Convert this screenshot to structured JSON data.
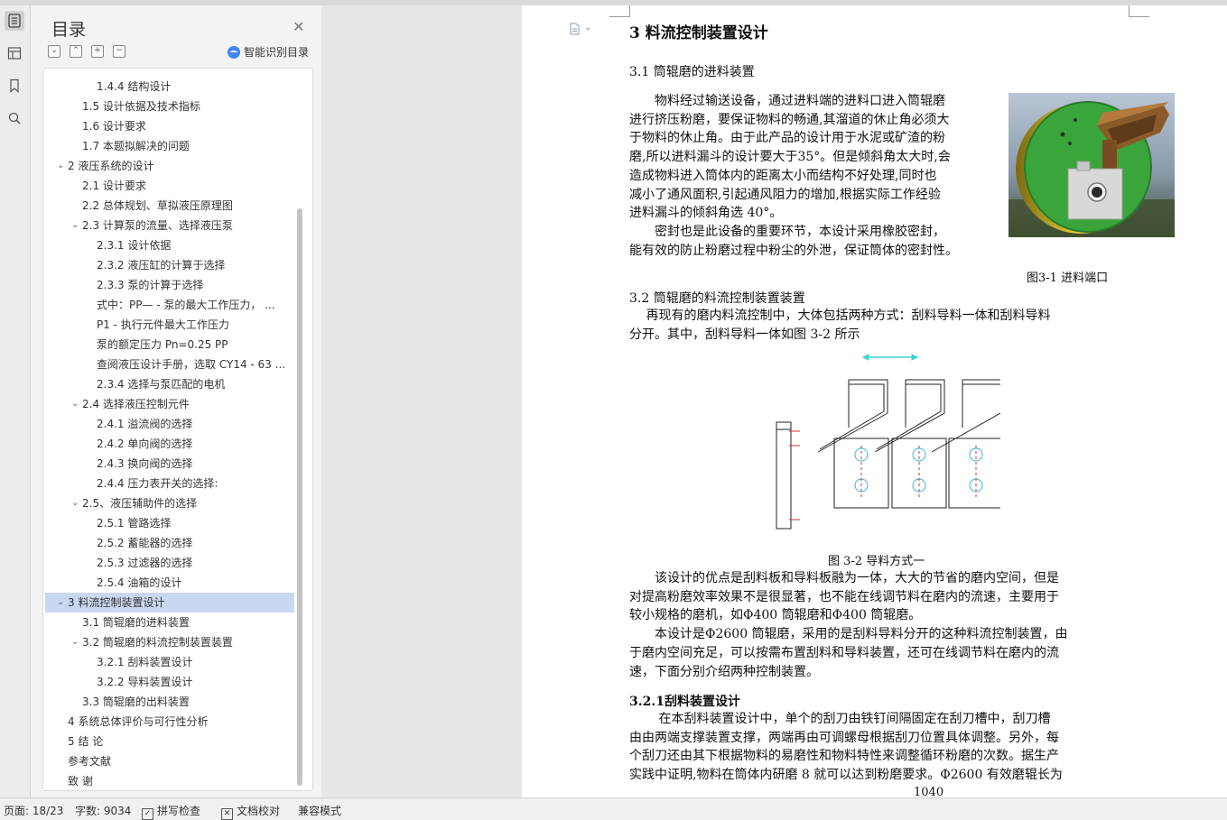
{
  "toc": {
    "title": "目录",
    "smart_label": "智能识别目录",
    "items": [
      {
        "label": "1.4.4  结构设计",
        "level": 3,
        "expandable": false,
        "selected": false
      },
      {
        "label": "1.5  设计依据及技术指标",
        "level": 2,
        "expandable": false,
        "selected": false
      },
      {
        "label": "1.6  设计要求",
        "level": 2,
        "expandable": false,
        "selected": false
      },
      {
        "label": "1.7  本题拟解决的问题",
        "level": 2,
        "expandable": false,
        "selected": false
      },
      {
        "label": "2   液压系统的设计",
        "level": 1,
        "expandable": true,
        "selected": false
      },
      {
        "label": "2.1  设计要求",
        "level": 2,
        "expandable": false,
        "selected": false
      },
      {
        "label": "2.2  总体规划、草拟液压原理图",
        "level": 2,
        "expandable": false,
        "selected": false
      },
      {
        "label": "2.3  计算泵的流量、选择液压泵",
        "level": 2,
        "expandable": true,
        "selected": false
      },
      {
        "label": "2.3.1  设计依据",
        "level": 3,
        "expandable": false,
        "selected": false
      },
      {
        "label": "2.3.2  液压缸的计算于选择",
        "level": 3,
        "expandable": false,
        "selected": false
      },
      {
        "label": "2.3.3  泵的计算于选择",
        "level": 3,
        "expandable": false,
        "selected": false
      },
      {
        "label": " 式中：PP— - 泵的最大工作压力， ...",
        "level": 3,
        "expandable": false,
        "selected": false
      },
      {
        "label": "P1 - 执行元件最大工作压力",
        "level": 3,
        "expandable": false,
        "selected": false
      },
      {
        "label": "泵的额定压力 Pn=0.25 PP",
        "level": 3,
        "expandable": false,
        "selected": false
      },
      {
        "label": "查阅液压设计手册，选取 CY14 - 63 ...",
        "level": 3,
        "expandable": false,
        "selected": false
      },
      {
        "label": "2.3.4  选择与泵匹配的电机",
        "level": 3,
        "expandable": false,
        "selected": false
      },
      {
        "label": "2.4  选择液压控制元件",
        "level": 2,
        "expandable": true,
        "selected": false
      },
      {
        "label": "2.4.1  溢流阀的选择",
        "level": 3,
        "expandable": false,
        "selected": false
      },
      {
        "label": "2.4.2  单向阀的选择",
        "level": 3,
        "expandable": false,
        "selected": false
      },
      {
        "label": "2.4.3  换向阀的选择",
        "level": 3,
        "expandable": false,
        "selected": false
      },
      {
        "label": "2.4.4  压力表开关的选择:",
        "level": 3,
        "expandable": false,
        "selected": false
      },
      {
        "label": "2.5、液压辅助件的选择",
        "level": 2,
        "expandable": true,
        "selected": false
      },
      {
        "label": "2.5.1  管路选择",
        "level": 3,
        "expandable": false,
        "selected": false
      },
      {
        "label": "2.5.2  蓄能器的选择",
        "level": 3,
        "expandable": false,
        "selected": false
      },
      {
        "label": "2.5.3  过滤器的选择",
        "level": 3,
        "expandable": false,
        "selected": false
      },
      {
        "label": "2.5.4  油箱的设计",
        "level": 3,
        "expandable": false,
        "selected": false
      },
      {
        "label": "3   料流控制装置设计",
        "level": 1,
        "expandable": true,
        "selected": true
      },
      {
        "label": "3.1  筒辊磨的进料装置",
        "level": 2,
        "expandable": false,
        "selected": false
      },
      {
        "label": "3.2  筒辊磨的料流控制装置装置",
        "level": 2,
        "expandable": true,
        "selected": false
      },
      {
        "label": "3.2.1 刮料装置设计",
        "level": 3,
        "expandable": false,
        "selected": false
      },
      {
        "label": "3.2.2  导料装置设计",
        "level": 3,
        "expandable": false,
        "selected": false
      },
      {
        "label": "3.3  筒辊磨的出料装置",
        "level": 2,
        "expandable": false,
        "selected": false
      },
      {
        "label": "4 系统总体评价与可行性分析",
        "level": 0,
        "expandable": false,
        "selected": false
      },
      {
        "label": "5 结   论",
        "level": 0,
        "expandable": false,
        "selected": false
      },
      {
        "label": "参考文献",
        "level": 0,
        "expandable": false,
        "selected": false
      },
      {
        "label": "致   谢",
        "level": 0,
        "expandable": false,
        "selected": false
      }
    ]
  },
  "doc": {
    "heading": "3   料流控制装置设计",
    "sec31": "3.1  筒辊磨的进料装置",
    "p1": [
      "　　物料经过输送设备，通过进料端的进料口进入筒辊磨",
      "进行挤压粉磨，要保证物料的畅通,其溜道的休止角必须大",
      "于物料的休止角。由于此产品的设计用于水泥或矿渣的粉",
      "磨,所以进料漏斗的设计要大于35°。但是倾斜角太大时,会",
      "造成物料进入筒体内的距离太小而结构不好处理,同时也",
      "减小了通风面积,引起通风阻力的增加,根据实际工作经验",
      "进料漏斗的倾斜角选 40°。"
    ],
    "p2": [
      "　　密封也是此设备的重要环节，本设计采用橡胶密封，",
      "能有效的防止粉磨过程中粉尘的外泄，保证筒体的密封性。"
    ],
    "fig1_caption": "图3-1 进料端口",
    "sec32": "3.2  筒辊磨的料流控制装置装置",
    "p3": [
      "　 再现有的磨内料流控制中，大体包括两种方式：刮料导料一体和刮料导料",
      "分开。其中，刮料导料一体如图 3-2 所示"
    ],
    "fig2_caption": "图 3-2   导料方式一",
    "p4": [
      "　　该设计的优点是刮料板和导料板融为一体，大大的节省的磨内空间，但是",
      "对提高粉磨效率效果不是很显著，也不能在线调节料在磨内的流速，主要用于",
      "较小规格的磨机，如Φ400 筒辊磨和Φ400 筒辊磨。",
      "　　本设计是Φ2600 筒辊磨，采用的是刮料导料分开的这种料流控制装置，由",
      "于磨内空间充足，可以按需布置刮料和导料装置，还可在线调节料在磨内的流",
      "速，下面分别介绍两种控制装置。"
    ],
    "sec321": "3.2.1刮料装置设计",
    "p5": [
      "　　 在本刮料装置设计中，单个的刮刀由铁钉间隔固定在刮刀槽中，刮刀槽",
      "由由两端支撑装置支撑，两端再由可调螺母根据刮刀位置具体调整。另外，每",
      "个刮刀还由其下根据物料的易磨性和物料特性来调整循环粉磨的次数。据生产",
      "实践中证明,物料在筒体内研磨 8 就可以达到粉磨要求。Φ2600 有效磨辊长为"
    ],
    "cut_number": "1040"
  },
  "status": {
    "page": "页面: 18/23",
    "words": "字数: 9034",
    "spell": "拼写检查",
    "proof": "文档校对",
    "compat": "兼容模式"
  },
  "icons": {
    "rail": [
      "toc-icon",
      "outline-icon",
      "bookmark-icon",
      "search-icon"
    ]
  },
  "colors": {
    "selection": "#c9d7f0",
    "accent": "#3f86f5"
  }
}
